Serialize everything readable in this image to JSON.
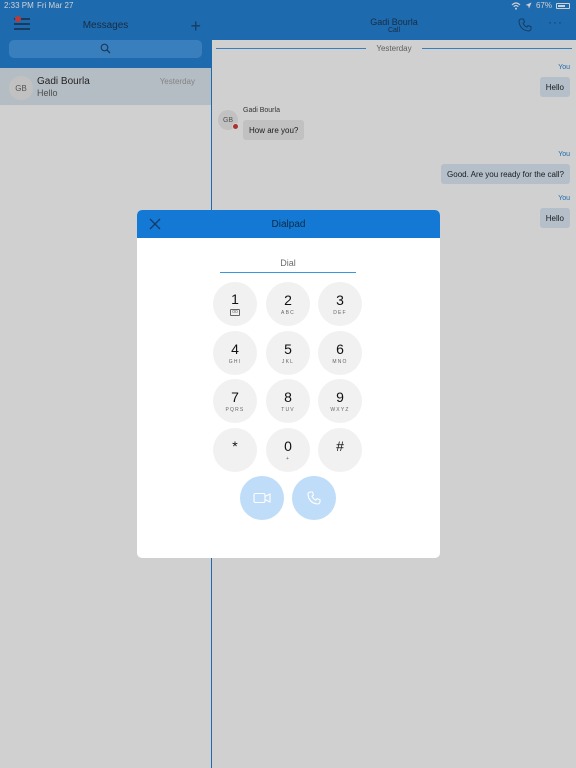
{
  "status_bar": {
    "time": "2:33 PM",
    "date": "Fri Mar 27",
    "battery": "67%"
  },
  "left_panel": {
    "title": "Messages",
    "conversation": {
      "initials": "GB",
      "name": "Gadi Bourla",
      "preview": "Hello",
      "time": "Yesterday"
    }
  },
  "right_panel": {
    "header": {
      "title": "Gadi Bourla",
      "subtitle": "Call"
    },
    "date_separator": "Yesterday",
    "messages": [
      {
        "sender_label": "You",
        "text": "Hello"
      },
      {
        "sender_label": "Gadi Bourla",
        "initials": "GB",
        "text": "How are you?"
      },
      {
        "sender_label": "You",
        "text": "Good. Are you ready for the call?"
      },
      {
        "sender_label": "You",
        "text": "Hello"
      }
    ]
  },
  "dialpad": {
    "title": "Dialpad",
    "input": {
      "placeholder": "Dial",
      "value": ""
    },
    "keys": [
      {
        "num": "1",
        "sub": ""
      },
      {
        "num": "2",
        "sub": "ABC"
      },
      {
        "num": "3",
        "sub": "DEF"
      },
      {
        "num": "4",
        "sub": "GHI"
      },
      {
        "num": "5",
        "sub": "JKL"
      },
      {
        "num": "6",
        "sub": "MNO"
      },
      {
        "num": "7",
        "sub": "PQRS"
      },
      {
        "num": "8",
        "sub": "TUV"
      },
      {
        "num": "9",
        "sub": "WXYZ"
      },
      {
        "num": "*",
        "sub": ""
      },
      {
        "num": "0",
        "sub": "+"
      },
      {
        "num": "#",
        "sub": ""
      }
    ]
  },
  "colors": {
    "primary": "#1479d4",
    "action_disabled": "#bfdcf8",
    "badge_red": "#d32f2f"
  },
  "icons": [
    "menu-icon",
    "plus-icon",
    "search-icon",
    "phone-icon",
    "more-icon",
    "close-icon",
    "voicemail-icon",
    "video-call-icon",
    "audio-call-icon",
    "wifi-icon",
    "battery-icon"
  ]
}
